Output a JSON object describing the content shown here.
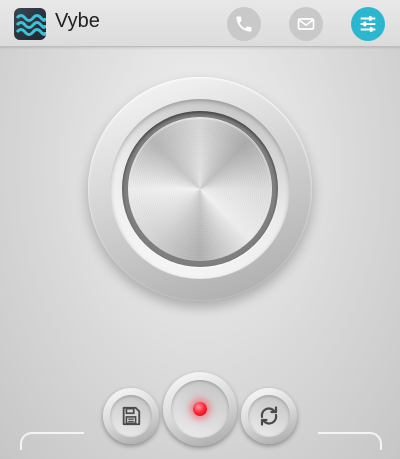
{
  "app": {
    "title": "Vybe",
    "logo_icon": "vybe-wave-logo"
  },
  "actionbar": {
    "items": [
      {
        "name": "phone",
        "icon": "phone-icon",
        "active": false
      },
      {
        "name": "mail",
        "icon": "envelope-icon",
        "active": false
      },
      {
        "name": "settings",
        "icon": "sliders-icon",
        "active": true
      }
    ]
  },
  "main_knob": {
    "icon": "vibration-knob"
  },
  "controls": {
    "save_icon": "save-icon",
    "record_icon": "record-icon",
    "repeat_icon": "repeat-icon"
  },
  "colors": {
    "accent": "#2cb7cf",
    "record": "#ff2a3a",
    "inactive_icon": "#c9c9c9"
  }
}
